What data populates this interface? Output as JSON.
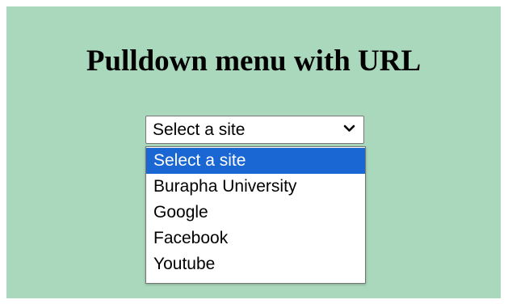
{
  "page": {
    "title": "Pulldown menu with URL",
    "background_color": "#aad8bc"
  },
  "select": {
    "value": "Select a site",
    "icon": "chevron-down-icon",
    "expanded": true,
    "options": [
      {
        "label": "Select a site",
        "highlighted": true
      },
      {
        "label": "Burapha University",
        "highlighted": false
      },
      {
        "label": "Google",
        "highlighted": false
      },
      {
        "label": "Facebook",
        "highlighted": false
      },
      {
        "label": "Youtube",
        "highlighted": false
      }
    ],
    "highlight_color": "#1a66d2"
  }
}
